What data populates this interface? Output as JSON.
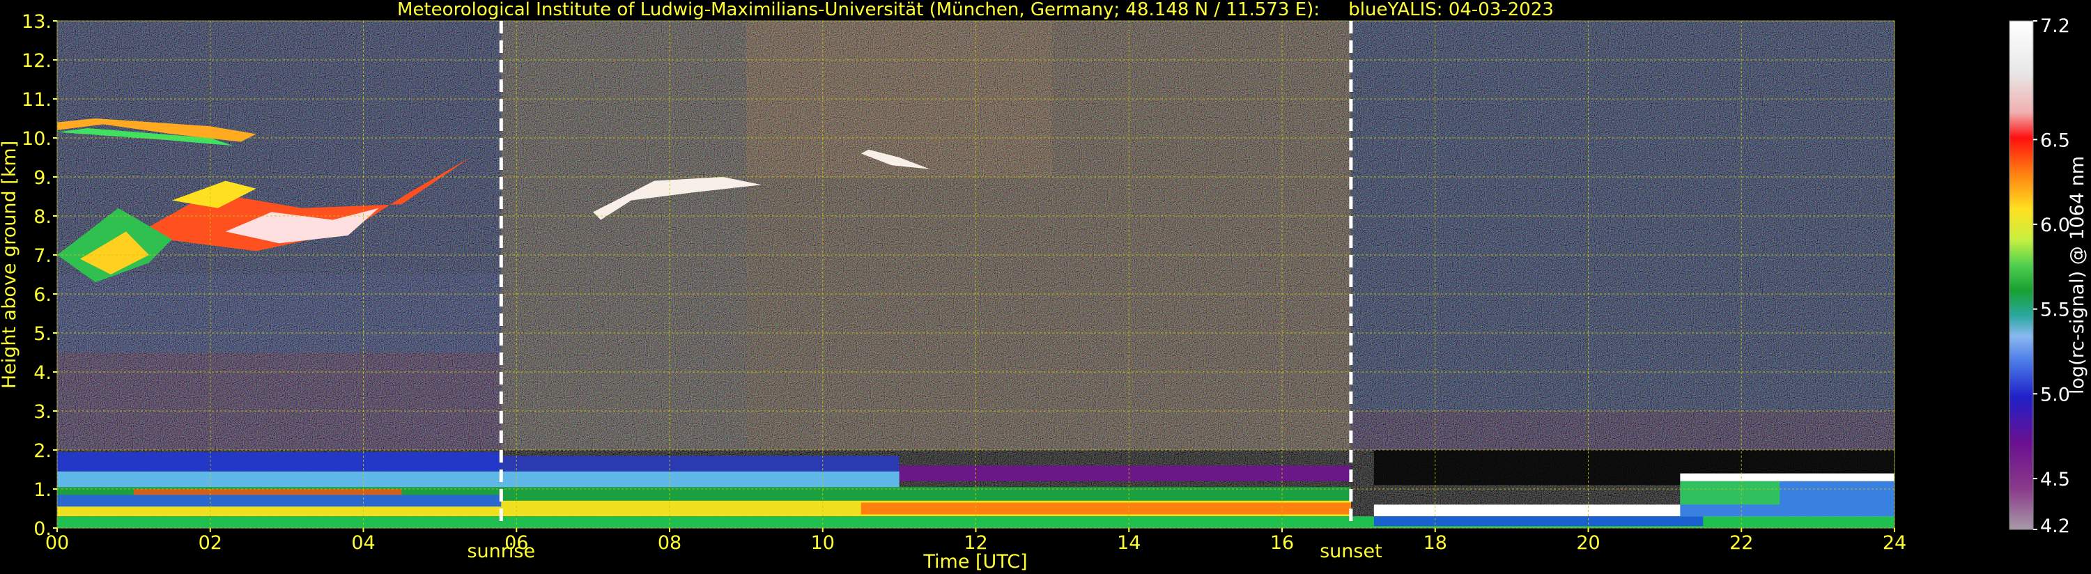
{
  "chart_data": {
    "type": "heatmap",
    "title": "Meteorological Institute of Ludwig-Maximilians-Universität (München, Germany; 48.148 N / 11.573 E):     blueYALIS: 04-03-2023",
    "xlabel": "Time [UTC]",
    "ylabel": "Height above ground [km]",
    "xlim": [
      0,
      24
    ],
    "ylim": [
      0,
      13
    ],
    "x_ticks": [
      "00",
      "02",
      "04",
      "06",
      "08",
      "10",
      "12",
      "14",
      "16",
      "18",
      "20",
      "22",
      "24"
    ],
    "y_ticks": [
      "0.",
      "1.",
      "2.",
      "3.",
      "4.",
      "5.",
      "6.",
      "7.",
      "8.",
      "9.",
      "10.",
      "11.",
      "12.",
      "13."
    ],
    "grid": true,
    "annotations": [
      {
        "text": "sunrise",
        "x": 5.8
      },
      {
        "text": "sunset",
        "x": 16.9
      }
    ],
    "colorbar": {
      "label": "log(rc-signal) @ 1064 nm",
      "range": [
        4.2,
        7.2
      ],
      "ticks": [
        "4.2",
        "4.5",
        "5.0",
        "5.5",
        "6.0",
        "6.5",
        "7.2"
      ]
    },
    "colors": {
      "axis_text": "#ffff33",
      "background": "#000000",
      "grid": "#c8c800"
    }
  }
}
